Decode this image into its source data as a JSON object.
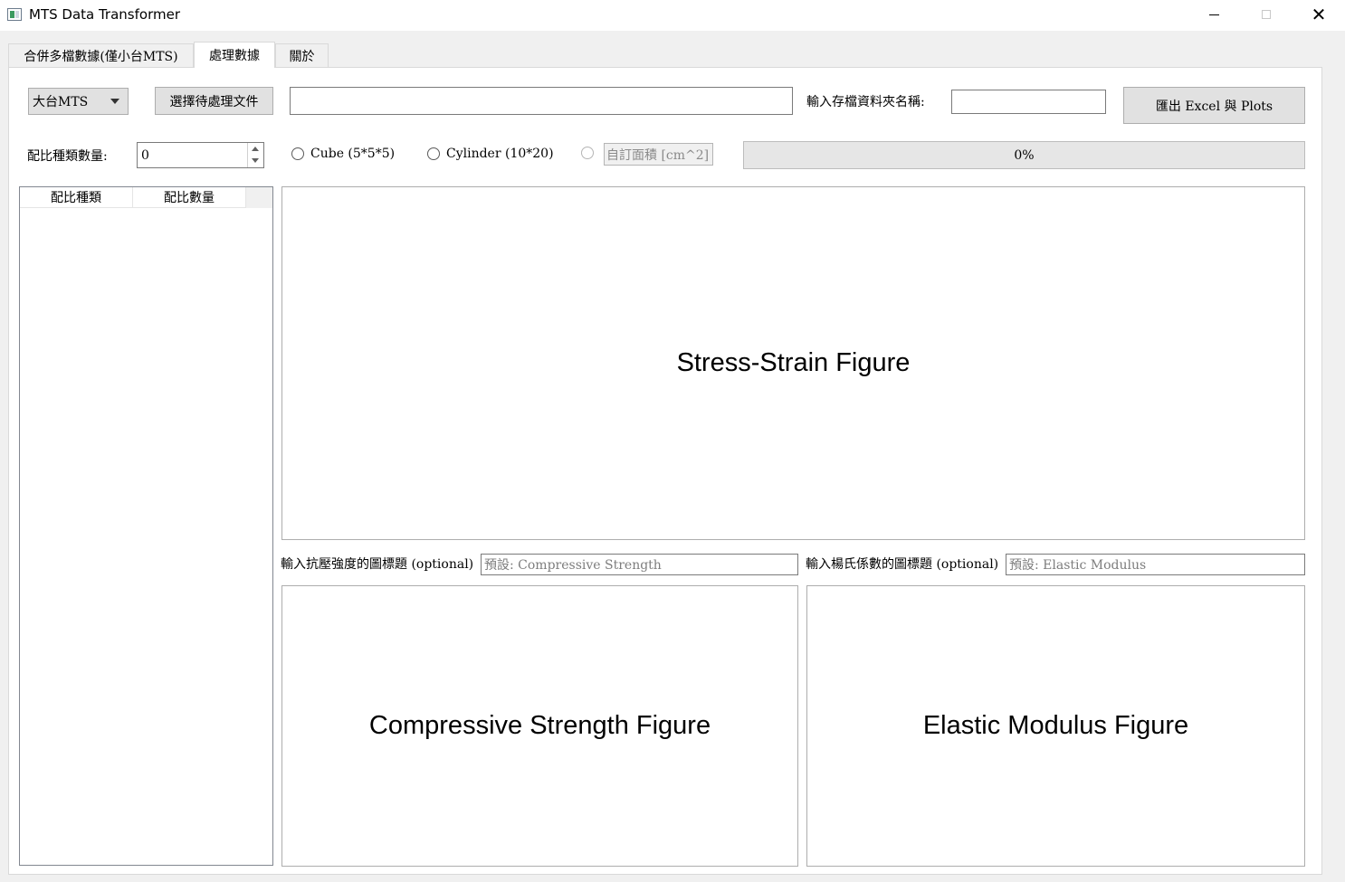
{
  "window": {
    "title": "MTS Data Transformer",
    "icon": "app-table-icon",
    "controls": [
      "minimize",
      "maximize",
      "close"
    ]
  },
  "tabs": [
    {
      "label": "合併多檔數據(僅小台MTS)",
      "active": false
    },
    {
      "label": "處理數據",
      "active": true
    },
    {
      "label": "關於",
      "active": false
    }
  ],
  "toolbar": {
    "machine_select": {
      "value": "大台MTS"
    },
    "select_file_button": "選擇待處理文件",
    "file_path": "",
    "folder_label": "輸入存檔資料夾名稱:",
    "folder_value": "",
    "export_button": "匯出 Excel 與 Plots"
  },
  "options": {
    "mix_count_label": "配比種類數量:",
    "mix_count_value": "0",
    "radios": [
      {
        "label": "Cube (5*5*5)",
        "checked": false,
        "enabled": true
      },
      {
        "label": "Cylinder (10*20)",
        "checked": false,
        "enabled": true
      },
      {
        "label": "",
        "checked": false,
        "enabled": false
      }
    ],
    "custom_area_placeholder": "自訂面積 [cm^2]",
    "progress_text": "0%",
    "progress_value": 0
  },
  "table": {
    "headers": [
      "配比種類",
      "配比數量"
    ],
    "rows": []
  },
  "figures": {
    "stress_strain": "Stress-Strain Figure",
    "compressive": "Compressive Strength Figure",
    "elastic": "Elastic Modulus Figure"
  },
  "titles": {
    "compressive_label": "輸入抗壓強度的圖標題 (optional)",
    "compressive_placeholder": "預設: Compressive Strength",
    "elastic_label": "輸入楊氏係數的圖標題 (optional)",
    "elastic_placeholder": "預設: Elastic Modulus"
  }
}
